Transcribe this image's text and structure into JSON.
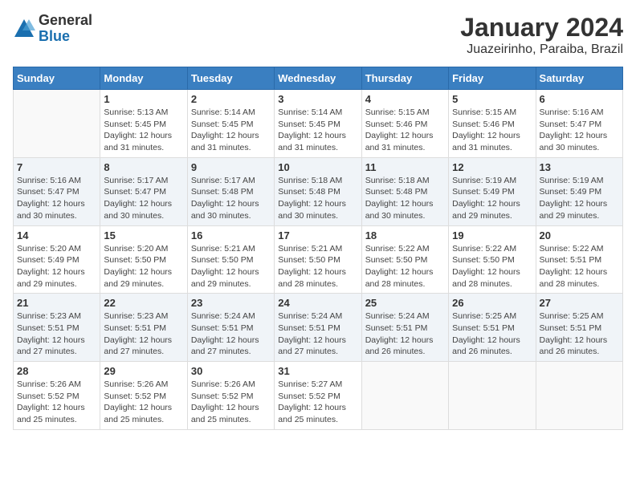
{
  "header": {
    "logo_general": "General",
    "logo_blue": "Blue",
    "title": "January 2024",
    "subtitle": "Juazeirinho, Paraiba, Brazil"
  },
  "calendar": {
    "days_of_week": [
      "Sunday",
      "Monday",
      "Tuesday",
      "Wednesday",
      "Thursday",
      "Friday",
      "Saturday"
    ],
    "weeks": [
      [
        {
          "day": "",
          "info": ""
        },
        {
          "day": "1",
          "info": "Sunrise: 5:13 AM\nSunset: 5:45 PM\nDaylight: 12 hours\nand 31 minutes."
        },
        {
          "day": "2",
          "info": "Sunrise: 5:14 AM\nSunset: 5:45 PM\nDaylight: 12 hours\nand 31 minutes."
        },
        {
          "day": "3",
          "info": "Sunrise: 5:14 AM\nSunset: 5:45 PM\nDaylight: 12 hours\nand 31 minutes."
        },
        {
          "day": "4",
          "info": "Sunrise: 5:15 AM\nSunset: 5:46 PM\nDaylight: 12 hours\nand 31 minutes."
        },
        {
          "day": "5",
          "info": "Sunrise: 5:15 AM\nSunset: 5:46 PM\nDaylight: 12 hours\nand 31 minutes."
        },
        {
          "day": "6",
          "info": "Sunrise: 5:16 AM\nSunset: 5:47 PM\nDaylight: 12 hours\nand 30 minutes."
        }
      ],
      [
        {
          "day": "7",
          "info": "Sunrise: 5:16 AM\nSunset: 5:47 PM\nDaylight: 12 hours\nand 30 minutes."
        },
        {
          "day": "8",
          "info": "Sunrise: 5:17 AM\nSunset: 5:47 PM\nDaylight: 12 hours\nand 30 minutes."
        },
        {
          "day": "9",
          "info": "Sunrise: 5:17 AM\nSunset: 5:48 PM\nDaylight: 12 hours\nand 30 minutes."
        },
        {
          "day": "10",
          "info": "Sunrise: 5:18 AM\nSunset: 5:48 PM\nDaylight: 12 hours\nand 30 minutes."
        },
        {
          "day": "11",
          "info": "Sunrise: 5:18 AM\nSunset: 5:48 PM\nDaylight: 12 hours\nand 30 minutes."
        },
        {
          "day": "12",
          "info": "Sunrise: 5:19 AM\nSunset: 5:49 PM\nDaylight: 12 hours\nand 29 minutes."
        },
        {
          "day": "13",
          "info": "Sunrise: 5:19 AM\nSunset: 5:49 PM\nDaylight: 12 hours\nand 29 minutes."
        }
      ],
      [
        {
          "day": "14",
          "info": "Sunrise: 5:20 AM\nSunset: 5:49 PM\nDaylight: 12 hours\nand 29 minutes."
        },
        {
          "day": "15",
          "info": "Sunrise: 5:20 AM\nSunset: 5:50 PM\nDaylight: 12 hours\nand 29 minutes."
        },
        {
          "day": "16",
          "info": "Sunrise: 5:21 AM\nSunset: 5:50 PM\nDaylight: 12 hours\nand 29 minutes."
        },
        {
          "day": "17",
          "info": "Sunrise: 5:21 AM\nSunset: 5:50 PM\nDaylight: 12 hours\nand 28 minutes."
        },
        {
          "day": "18",
          "info": "Sunrise: 5:22 AM\nSunset: 5:50 PM\nDaylight: 12 hours\nand 28 minutes."
        },
        {
          "day": "19",
          "info": "Sunrise: 5:22 AM\nSunset: 5:50 PM\nDaylight: 12 hours\nand 28 minutes."
        },
        {
          "day": "20",
          "info": "Sunrise: 5:22 AM\nSunset: 5:51 PM\nDaylight: 12 hours\nand 28 minutes."
        }
      ],
      [
        {
          "day": "21",
          "info": "Sunrise: 5:23 AM\nSunset: 5:51 PM\nDaylight: 12 hours\nand 27 minutes."
        },
        {
          "day": "22",
          "info": "Sunrise: 5:23 AM\nSunset: 5:51 PM\nDaylight: 12 hours\nand 27 minutes."
        },
        {
          "day": "23",
          "info": "Sunrise: 5:24 AM\nSunset: 5:51 PM\nDaylight: 12 hours\nand 27 minutes."
        },
        {
          "day": "24",
          "info": "Sunrise: 5:24 AM\nSunset: 5:51 PM\nDaylight: 12 hours\nand 27 minutes."
        },
        {
          "day": "25",
          "info": "Sunrise: 5:24 AM\nSunset: 5:51 PM\nDaylight: 12 hours\nand 26 minutes."
        },
        {
          "day": "26",
          "info": "Sunrise: 5:25 AM\nSunset: 5:51 PM\nDaylight: 12 hours\nand 26 minutes."
        },
        {
          "day": "27",
          "info": "Sunrise: 5:25 AM\nSunset: 5:51 PM\nDaylight: 12 hours\nand 26 minutes."
        }
      ],
      [
        {
          "day": "28",
          "info": "Sunrise: 5:26 AM\nSunset: 5:52 PM\nDaylight: 12 hours\nand 25 minutes."
        },
        {
          "day": "29",
          "info": "Sunrise: 5:26 AM\nSunset: 5:52 PM\nDaylight: 12 hours\nand 25 minutes."
        },
        {
          "day": "30",
          "info": "Sunrise: 5:26 AM\nSunset: 5:52 PM\nDaylight: 12 hours\nand 25 minutes."
        },
        {
          "day": "31",
          "info": "Sunrise: 5:27 AM\nSunset: 5:52 PM\nDaylight: 12 hours\nand 25 minutes."
        },
        {
          "day": "",
          "info": ""
        },
        {
          "day": "",
          "info": ""
        },
        {
          "day": "",
          "info": ""
        }
      ]
    ]
  }
}
